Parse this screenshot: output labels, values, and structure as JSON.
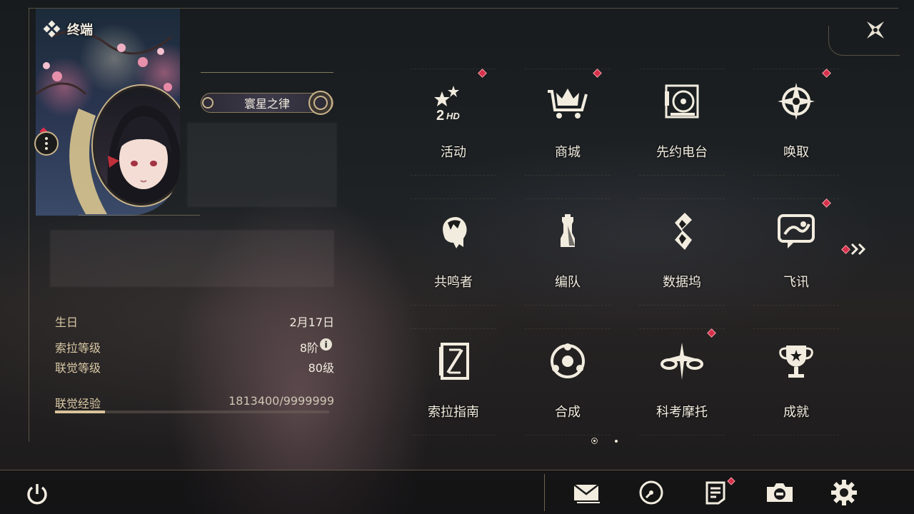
{
  "header": {
    "title": "终端",
    "title_icon": "diamond-cluster-icon",
    "close_icon": "close-star-icon"
  },
  "profile": {
    "title_badge": "寰星之律",
    "stats": {
      "birthday_label": "生日",
      "birthday_value": "2月17日",
      "sola_label": "索拉等级",
      "sola_value": "8阶",
      "info_icon_text": "i",
      "union_label": "联觉等级",
      "union_value": "80级",
      "exp_label": "联觉经验",
      "exp_value": "1813400/9999999",
      "exp_progress": 0.1813
    }
  },
  "menu": {
    "items": [
      {
        "label": "活动",
        "icon": "event-2hd-icon",
        "badge": true
      },
      {
        "label": "商城",
        "icon": "shop-cart-icon",
        "badge": true
      },
      {
        "label": "先约电台",
        "icon": "radio-disc-icon",
        "badge": false
      },
      {
        "label": "唤取",
        "icon": "compass-star-icon",
        "badge": true
      },
      {
        "label": "共鸣者",
        "icon": "resonator-head-icon",
        "badge": false
      },
      {
        "label": "编队",
        "icon": "chess-team-icon",
        "badge": false
      },
      {
        "label": "数据坞",
        "icon": "data-dock-icon",
        "badge": false
      },
      {
        "label": "飞讯",
        "icon": "message-bubble-icon",
        "badge": true
      },
      {
        "label": "索拉指南",
        "icon": "guide-book-icon",
        "badge": false
      },
      {
        "label": "合成",
        "icon": "synthesis-orbit-icon",
        "badge": false
      },
      {
        "label": "科考摩托",
        "icon": "motorbike-icon",
        "badge": true
      },
      {
        "label": "成就",
        "icon": "trophy-icon",
        "badge": false
      }
    ],
    "pagination": {
      "current_page": 1,
      "total_pages": 2
    },
    "next_icon": "double-chevron-right-icon"
  },
  "bottom_bar": {
    "icons": [
      "power-icon",
      "mail-icon",
      "clock-icon",
      "notes-icon",
      "camera-icon",
      "gear-icon"
    ]
  },
  "colors": {
    "accent_gold": "#c9b48a",
    "badge_red": "#d8304a",
    "text": "#f2ecdf"
  }
}
